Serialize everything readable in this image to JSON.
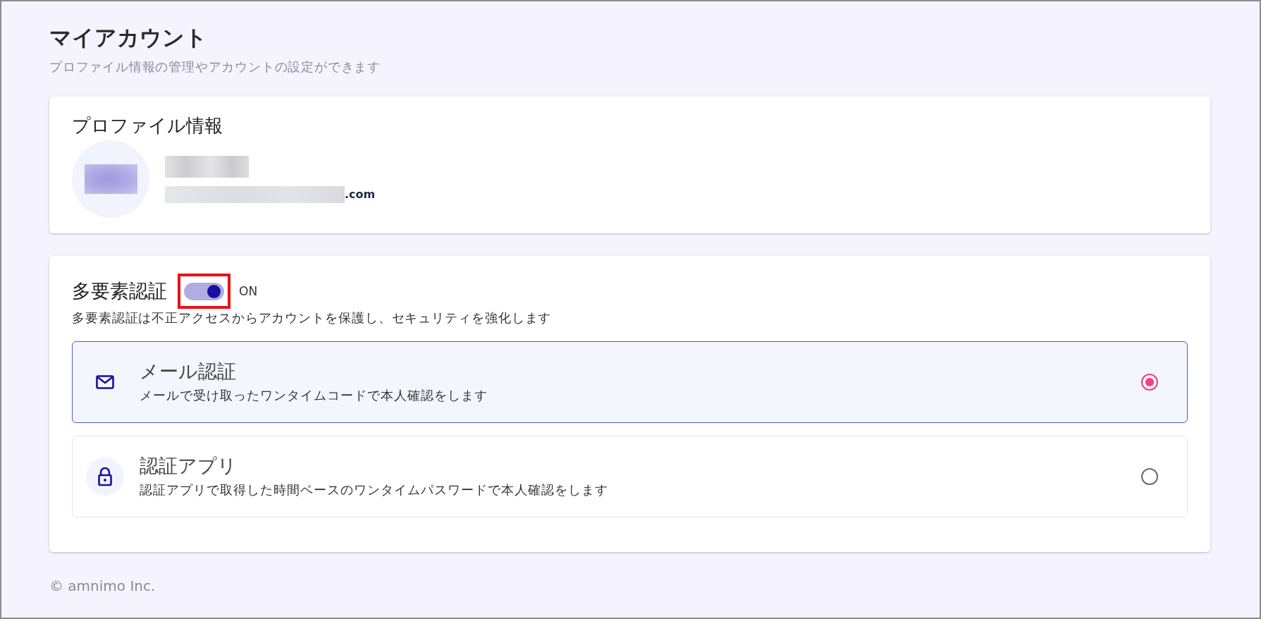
{
  "page": {
    "title": "マイアカウント",
    "subtitle": "プロファイル情報の管理やアカウントの設定ができます"
  },
  "profile": {
    "title": "プロファイル情報",
    "avatar_redacted": true,
    "name_redacted": true,
    "email_redacted": true,
    "email": ".com"
  },
  "mfa": {
    "title": "多要素認証",
    "toggle": {
      "on": true,
      "highlighted": true
    },
    "state_label": "ON",
    "description": "多要素認証は不正アクセスからアカウントを保護し、セキュリティを強化します",
    "options": [
      {
        "kind": "mail",
        "title": "メール認証",
        "description": "メールで受け取ったワンタイムコードで本人確認をします",
        "selected": true
      },
      {
        "kind": "app",
        "title": "認証アプリ",
        "description": "認証アプリで取得した時間ベースのワンタイムパスワードで本人確認をします",
        "selected": false
      }
    ]
  },
  "footer": {
    "copyright": "© amnimo Inc."
  }
}
